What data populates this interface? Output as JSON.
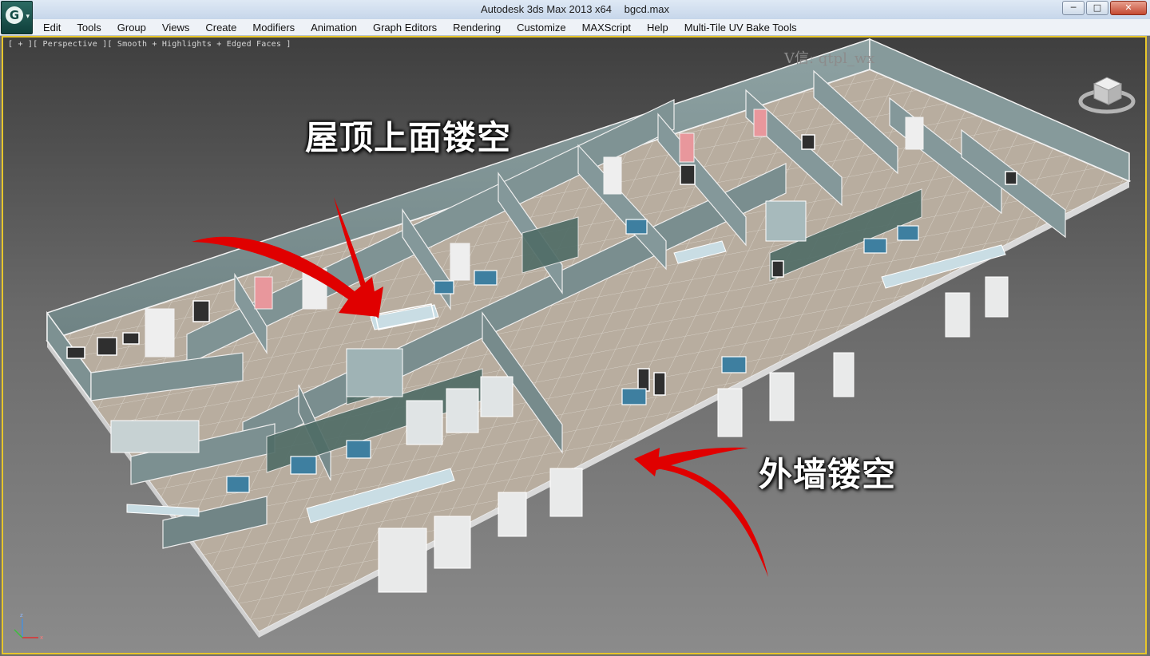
{
  "titlebar": {
    "app": "Autodesk 3ds Max  2013 x64",
    "file": "bgcd.max",
    "minimize": "─",
    "restore": "□",
    "close": "✕"
  },
  "app_button": {
    "glyph": "G",
    "caret": "▾"
  },
  "menu": [
    "Edit",
    "Tools",
    "Group",
    "Views",
    "Create",
    "Modifiers",
    "Animation",
    "Graph Editors",
    "Rendering",
    "Customize",
    "MAXScript",
    "Help",
    "Multi-Tile UV Bake Tools"
  ],
  "viewport": {
    "label": "[ + ][ Perspective ][ Smooth + Highlights + Edged Faces ]",
    "watermark": "V信: qtpl_wx"
  },
  "annotations": {
    "roof": "屋顶上面镂空",
    "wall": "外墙镂空"
  },
  "colors": {
    "selection_border": "#e7c62b",
    "annotation_arrow": "#e00000",
    "wall": "#7b8f90",
    "floor": "#b6ab9d"
  }
}
